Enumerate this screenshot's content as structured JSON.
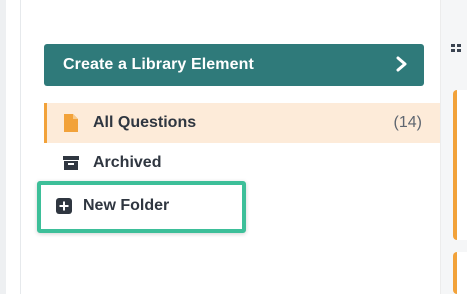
{
  "sidebar": {
    "create_button": {
      "label": "Create a Library Element",
      "chevron": "chevron-right-icon"
    },
    "items": [
      {
        "label": "All Questions",
        "count": "(14)",
        "icon": "document-icon",
        "active": true
      },
      {
        "label": "Archived",
        "icon": "archive-box-icon",
        "active": false
      }
    ],
    "new_folder": {
      "label": "New Folder",
      "icon": "plus-square-icon"
    }
  },
  "colors": {
    "primary_button": "#2f7a7a",
    "active_bg": "#fdebd9",
    "accent_orange": "#f2a23a",
    "highlight_green": "#3dbf99",
    "text_dark": "#2f3640"
  }
}
